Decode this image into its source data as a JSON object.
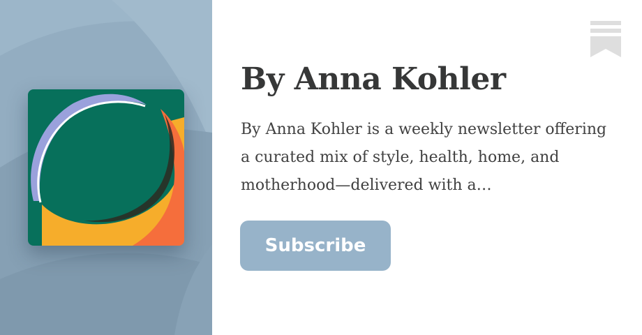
{
  "publication": {
    "title": "By Anna Kohler",
    "description": "By Anna Kohler is a weekly newsletter offering a curated mix of style, health, home, and motherhood—delivered with a…",
    "subscribe_label": "Subscribe",
    "logo_icon": "circle-swirl-logo-icon",
    "bookmark_icon": "bookmark-icon"
  },
  "colors": {
    "left_panel_background": "#8fa9bd",
    "logo_green": "#07705b",
    "logo_orange": "#f56e3c",
    "logo_yellow": "#f6ad2b",
    "logo_lavender": "#9aa1dc",
    "button_background": "#97b3c9",
    "title_text": "#363737",
    "bookmark": "#dedede"
  }
}
